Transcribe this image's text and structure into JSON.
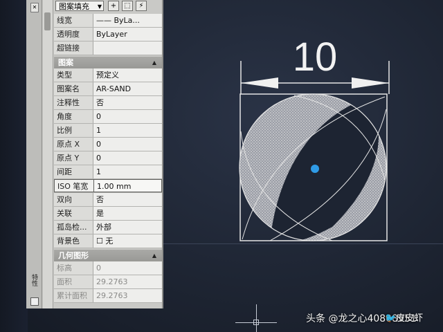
{
  "palette": {
    "dropdown": "图案填充",
    "side_label": "特性",
    "top_rows": [
      {
        "key": "线宽",
        "value": "—— ByLa..."
      },
      {
        "key": "透明度",
        "value": "ByLayer"
      },
      {
        "key": "超链接",
        "value": ""
      }
    ],
    "pattern_section": "图案",
    "pattern_rows": [
      {
        "key": "类型",
        "value": "预定义"
      },
      {
        "key": "图案名",
        "value": "AR-SAND"
      },
      {
        "key": "注释性",
        "value": "否"
      },
      {
        "key": "角度",
        "value": "0"
      },
      {
        "key": "比例",
        "value": "1"
      },
      {
        "key": "原点 X",
        "value": "0"
      },
      {
        "key": "原点 Y",
        "value": "0"
      },
      {
        "key": "间距",
        "value": "1"
      },
      {
        "key": "ISO 笔宽",
        "value": "1.00 mm"
      },
      {
        "key": "双向",
        "value": "否"
      },
      {
        "key": "关联",
        "value": "是"
      },
      {
        "key": "孤岛检...",
        "value": "外部"
      },
      {
        "key": "背景色",
        "value": "☐ 无"
      }
    ],
    "geometry_section": "几何图形",
    "geometry_rows": [
      {
        "key": "标高",
        "value": "0"
      },
      {
        "key": "面积",
        "value": "29.2763"
      },
      {
        "key": "累计面积",
        "value": "29.2763"
      }
    ]
  },
  "drawing": {
    "dimension_text": "10",
    "center_point_color": "#2f9be6",
    "line_color": "#e6e6e6"
  },
  "watermark": {
    "text": "头条 @龙之心40808951",
    "logo_text": "🐦皮皮虾"
  }
}
